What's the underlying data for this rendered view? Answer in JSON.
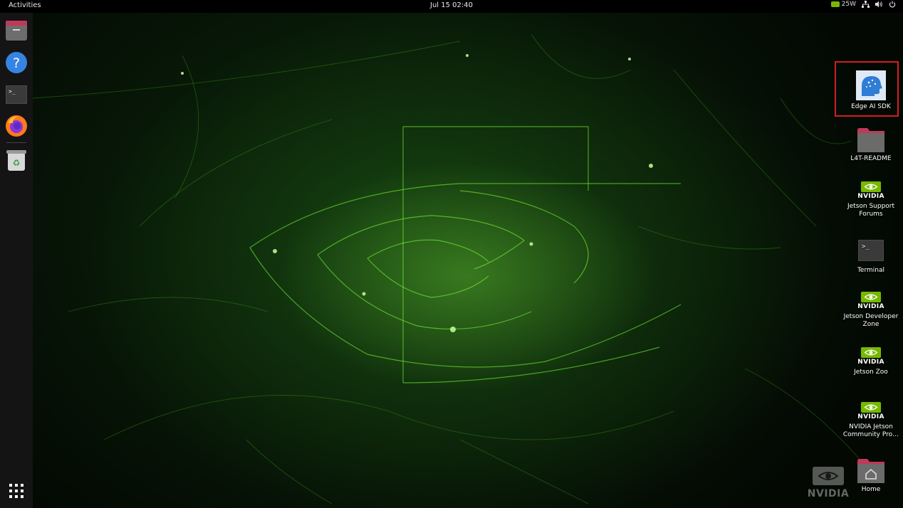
{
  "topbar": {
    "activities": "Activities",
    "datetime": "Jul 15  02:40",
    "power_mode": "25W"
  },
  "dock": {
    "items": [
      {
        "name": "Files",
        "icon": "files-icon"
      },
      {
        "name": "Help",
        "icon": "help-icon"
      },
      {
        "name": "Terminal",
        "icon": "terminal-icon"
      },
      {
        "name": "Firefox",
        "icon": "firefox-icon"
      },
      {
        "name": "Trash",
        "icon": "trash-icon"
      }
    ],
    "show_apps_icon": "app-grid-icon"
  },
  "desktop": {
    "icons": [
      {
        "label": "Edge AI SDK",
        "icon": "edge-ai-sdk-icon",
        "selected": true
      },
      {
        "label": "L4T-README",
        "icon": "folder-icon"
      },
      {
        "label": "Jetson Support Forums",
        "icon": "nvidia-icon"
      },
      {
        "label": "Terminal",
        "icon": "terminal-icon"
      },
      {
        "label": "Jetson Developer Zone",
        "icon": "nvidia-icon"
      },
      {
        "label": "Jetson Zoo",
        "icon": "nvidia-icon"
      },
      {
        "label": "NVIDIA Jetson Community Pro…",
        "icon": "nvidia-icon"
      },
      {
        "label": "Home",
        "icon": "home-folder-icon"
      }
    ],
    "nvidia_wordmark": "NVIDIA",
    "watermark": "NVIDIA"
  },
  "colors": {
    "nvidia_green": "#76b900",
    "selection_outline": "#d11f1f",
    "dock_bg": "#141414",
    "topbar_bg": "#000000"
  }
}
